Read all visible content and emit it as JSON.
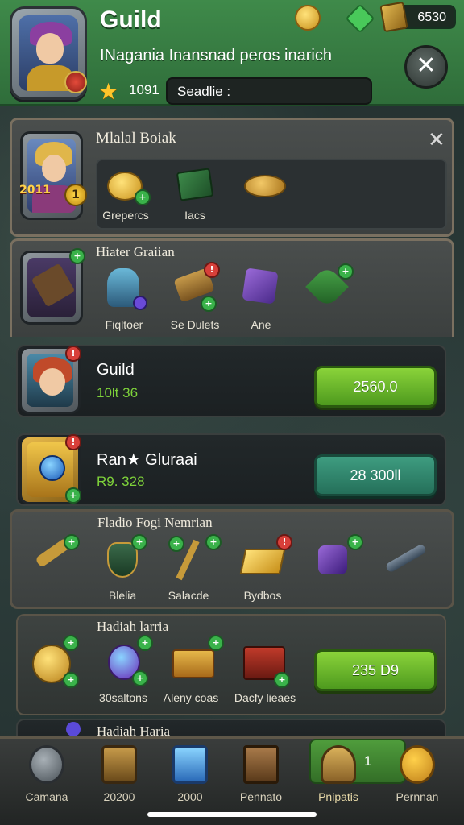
{
  "header": {
    "title": "Guild",
    "subtitle": "INagania Inansnad peros inarich",
    "stars": "1091",
    "search_text": "Seadlie  :",
    "currency_value": "6530"
  },
  "panel1": {
    "title": "Mlalal Boiak",
    "badge": "1",
    "badge_label": "2011",
    "items": [
      {
        "label": "Grepercs"
      },
      {
        "label": "Iacs"
      },
      {
        "label": ""
      }
    ]
  },
  "panel2": {
    "title": "Hiater Graiian",
    "items": [
      {
        "label": "Fiqltoer"
      },
      {
        "label": "Se Dulets"
      },
      {
        "label": "Ane"
      },
      {
        "label": ""
      }
    ]
  },
  "row_guild": {
    "name": "Guild",
    "value": "10lt 36",
    "button": "2560.0"
  },
  "row_rank": {
    "name": "Ran★ Gluraai",
    "value": "R9. 328",
    "button": "28 300ll"
  },
  "panel3": {
    "title": "Fladio Fogi Nemrian",
    "items": [
      {
        "label": ""
      },
      {
        "label": "Blelia"
      },
      {
        "label": "Salacde"
      },
      {
        "label": "Bydbos"
      },
      {
        "label": ""
      },
      {
        "label": ""
      }
    ]
  },
  "panel4": {
    "title": "Hadiah larria",
    "items": [
      {
        "label": ""
      },
      {
        "label": "30saltons"
      },
      {
        "label": "Aleny coas"
      },
      {
        "label": "Dacfy lieaes"
      }
    ],
    "button": "235 D9"
  },
  "partial_title": "Hadiah Haria",
  "nav": {
    "items": [
      {
        "label": "Camana"
      },
      {
        "label": "20200"
      },
      {
        "label": "2000"
      },
      {
        "label": "Pennato"
      },
      {
        "label": "Pnipatis"
      },
      {
        "label": "Pernnan"
      }
    ],
    "active_count": "1"
  },
  "colors": {
    "header_green": "#3f8a4a",
    "button_green": "#6cbb2a",
    "button_teal": "#2f8a6c",
    "value_green": "#7ed23a"
  }
}
